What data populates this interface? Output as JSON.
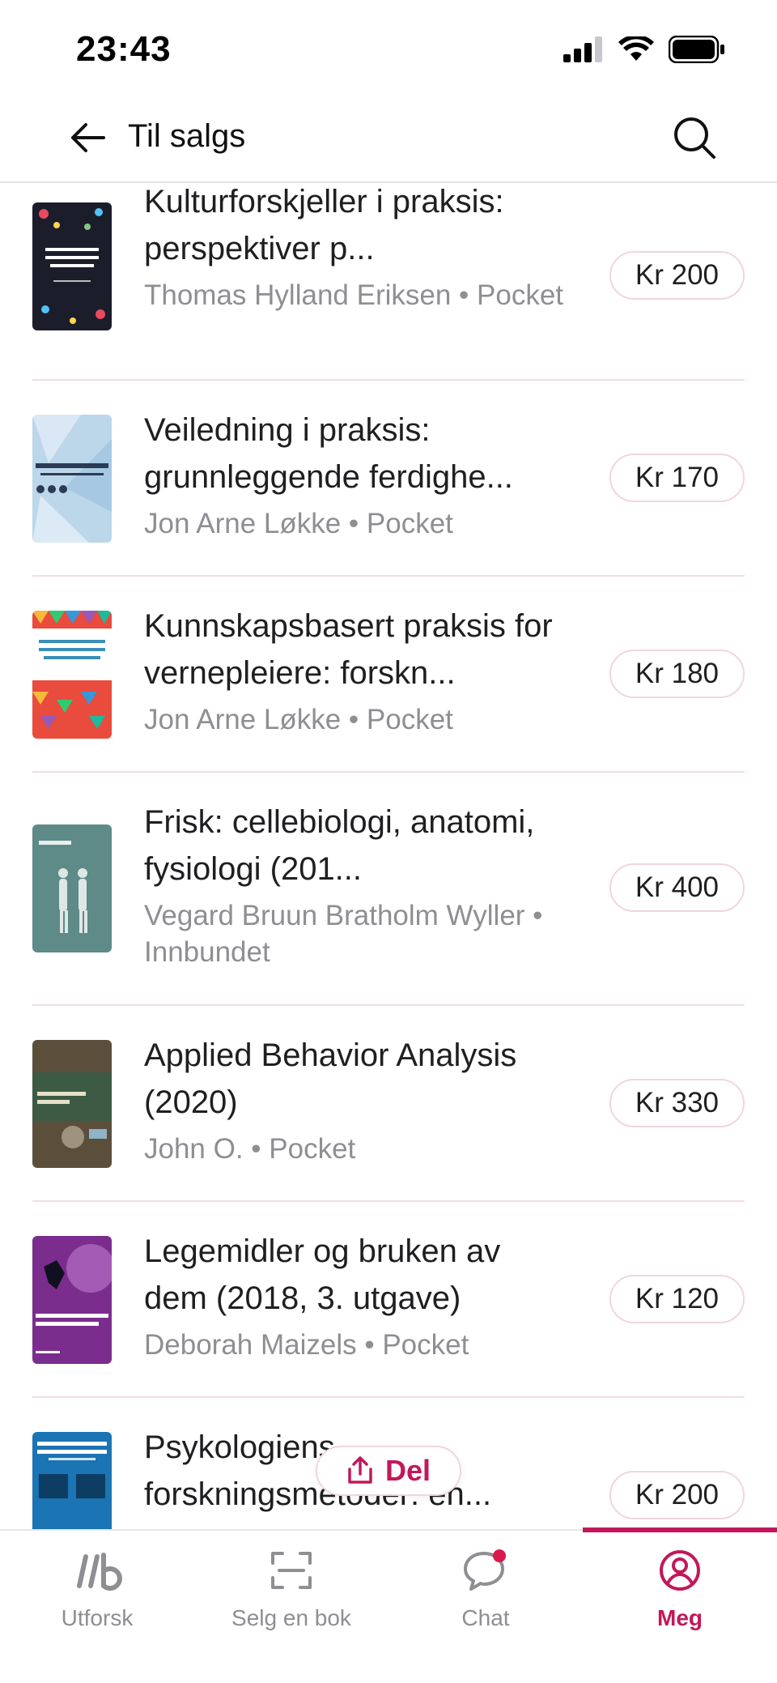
{
  "status_bar": {
    "time": "23:43"
  },
  "header": {
    "title": "Til salgs"
  },
  "books": [
    {
      "title": "Kulturforskjeller i praksis: perspektiver p...",
      "meta": "Thomas Hylland Eriksen • Pocket",
      "price": "Kr 200",
      "cover_color": "#1b1d2b",
      "cover_text": "KULTUR-FORSKJELLER I PRAKSIS"
    },
    {
      "title": "Veiledning i praksis: grunnleggende ferdighe...",
      "meta": "Jon Arne Løkke • Pocket",
      "price": "Kr 170",
      "cover_color": "#bcd6ea",
      "cover_text": "Veiledning i praksis"
    },
    {
      "title": "Kunnskapsbasert praksis for vernepleiere: forskn...",
      "meta": "Jon Arne Løkke • Pocket",
      "price": "Kr 180",
      "cover_color": "#e94b3c",
      "cover_text": "KUNNSKAPSBASERT PRAKSIS FOR VERNEPLEIERE"
    },
    {
      "title": "Frisk: cellebiologi, anatomi, fysiologi (201...",
      "meta": "Vegard Bruun Bratholm Wyller • Innbundet",
      "price": "Kr 400",
      "cover_color": "#5e8a87",
      "cover_text": "Frisk"
    },
    {
      "title": "Applied Behavior Analysis (2020)",
      "meta": "John O. • Pocket",
      "price": "Kr 330",
      "cover_color": "#5b4e3b",
      "cover_text": "Applied Behavior Analysis"
    },
    {
      "title": "Legemidler og bruken av dem (2018, 3. utgave)",
      "meta": "Deborah Maizels • Pocket",
      "price": "Kr 120",
      "cover_color": "#7b2d8e",
      "cover_text": "LEGEMIDLER OG BRUKEN AV DEM"
    },
    {
      "title": "Psykologiens forskningsmetoder: en...",
      "meta": "",
      "price": "Kr 200",
      "cover_color": "#1b74b3",
      "cover_text": "PSYKOLOGIENS FORSKNINGSMETODER"
    }
  ],
  "share": {
    "label": "Del"
  },
  "tabs": [
    {
      "label": "Utforsk",
      "icon": "explore-icon"
    },
    {
      "label": "Selg en bok",
      "icon": "scan-icon"
    },
    {
      "label": "Chat",
      "icon": "chat-icon"
    },
    {
      "label": "Meg",
      "icon": "profile-icon"
    }
  ],
  "colors": {
    "accent": "#c2185b",
    "muted": "#8e8e93",
    "divider": "#f1dde3"
  }
}
